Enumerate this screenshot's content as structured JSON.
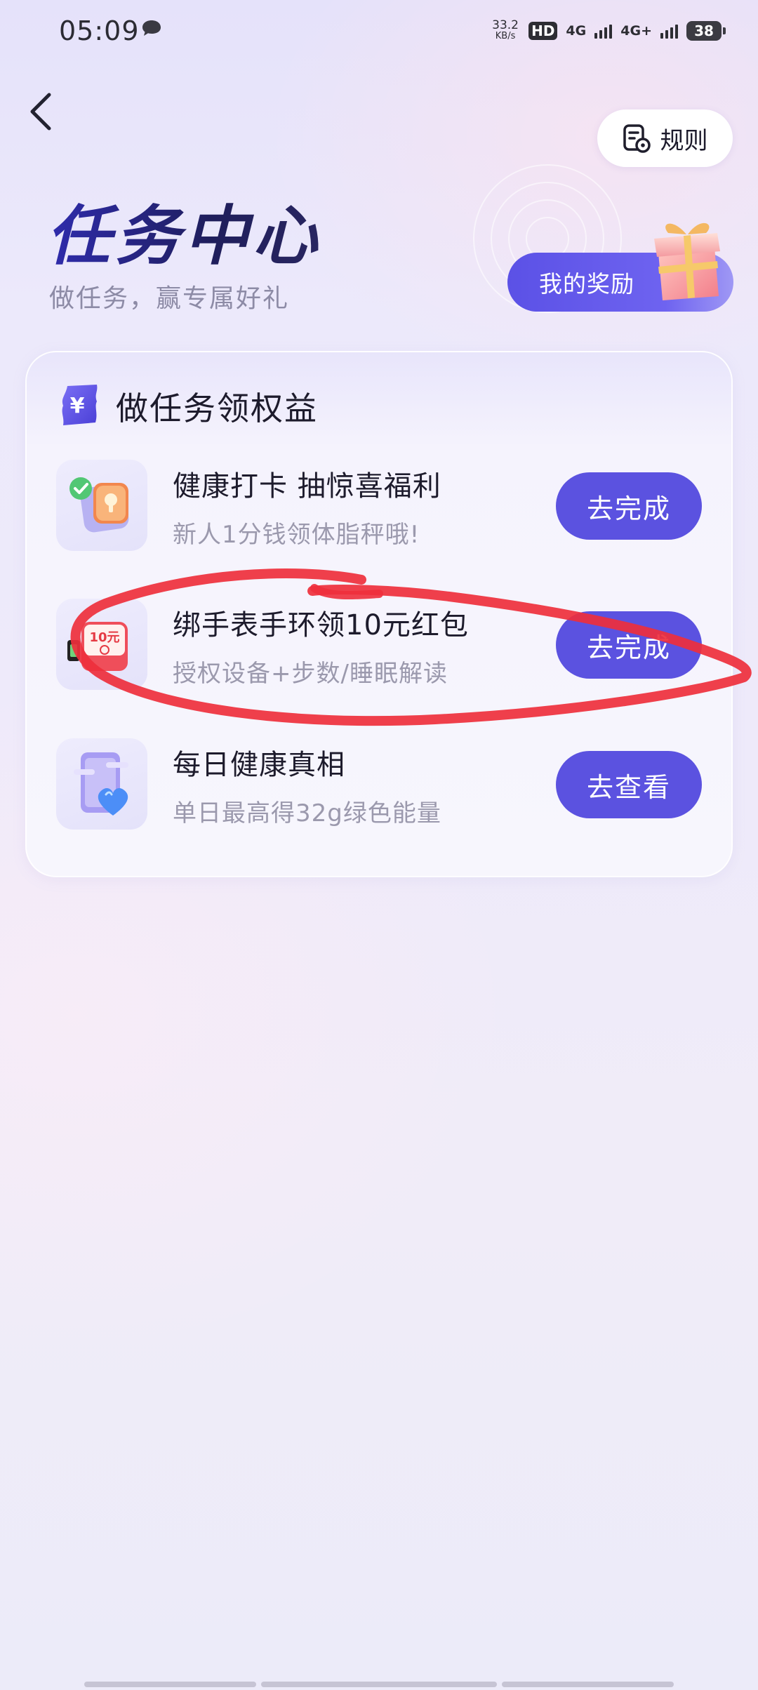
{
  "status_bar": {
    "time": "05:09",
    "net_speed_value": "33.2",
    "net_speed_unit": "KB/s",
    "hd": "HD",
    "network1": "4G",
    "network2": "4G+",
    "battery": "38",
    "icons": [
      "message-icon",
      "signal-icon",
      "battery-icon"
    ]
  },
  "header": {
    "back_icon": "chevron-left-icon",
    "rules_label": "规则",
    "rules_icon": "document-gear-icon",
    "title": "任务中心",
    "subtitle": "做任务，赢专属好礼",
    "rewards_label": "我的奖励",
    "rewards_icon": "gift-box-icon"
  },
  "task_card": {
    "title": "做任务领权益",
    "title_icon": "yuan-ticket-icon",
    "tasks": [
      {
        "name": "健康打卡 抽惊喜福利",
        "desc": "新人1分钱领体脂秤哦!",
        "button": "去完成",
        "icon": "health-checkin-icon"
      },
      {
        "name": "绑手表手环领10元红包",
        "desc": "授权设备+步数/睡眠解读",
        "button": "去完成",
        "icon": "red-packet-icon",
        "icon_text": "10元"
      },
      {
        "name": "每日健康真相",
        "desc": "单日最高得32g绿色能量",
        "button": "去查看",
        "icon": "phone-heart-icon"
      }
    ]
  },
  "colors": {
    "accent": "#5b52e0",
    "title": "#22206e",
    "annotation": "#ee2f3c"
  }
}
